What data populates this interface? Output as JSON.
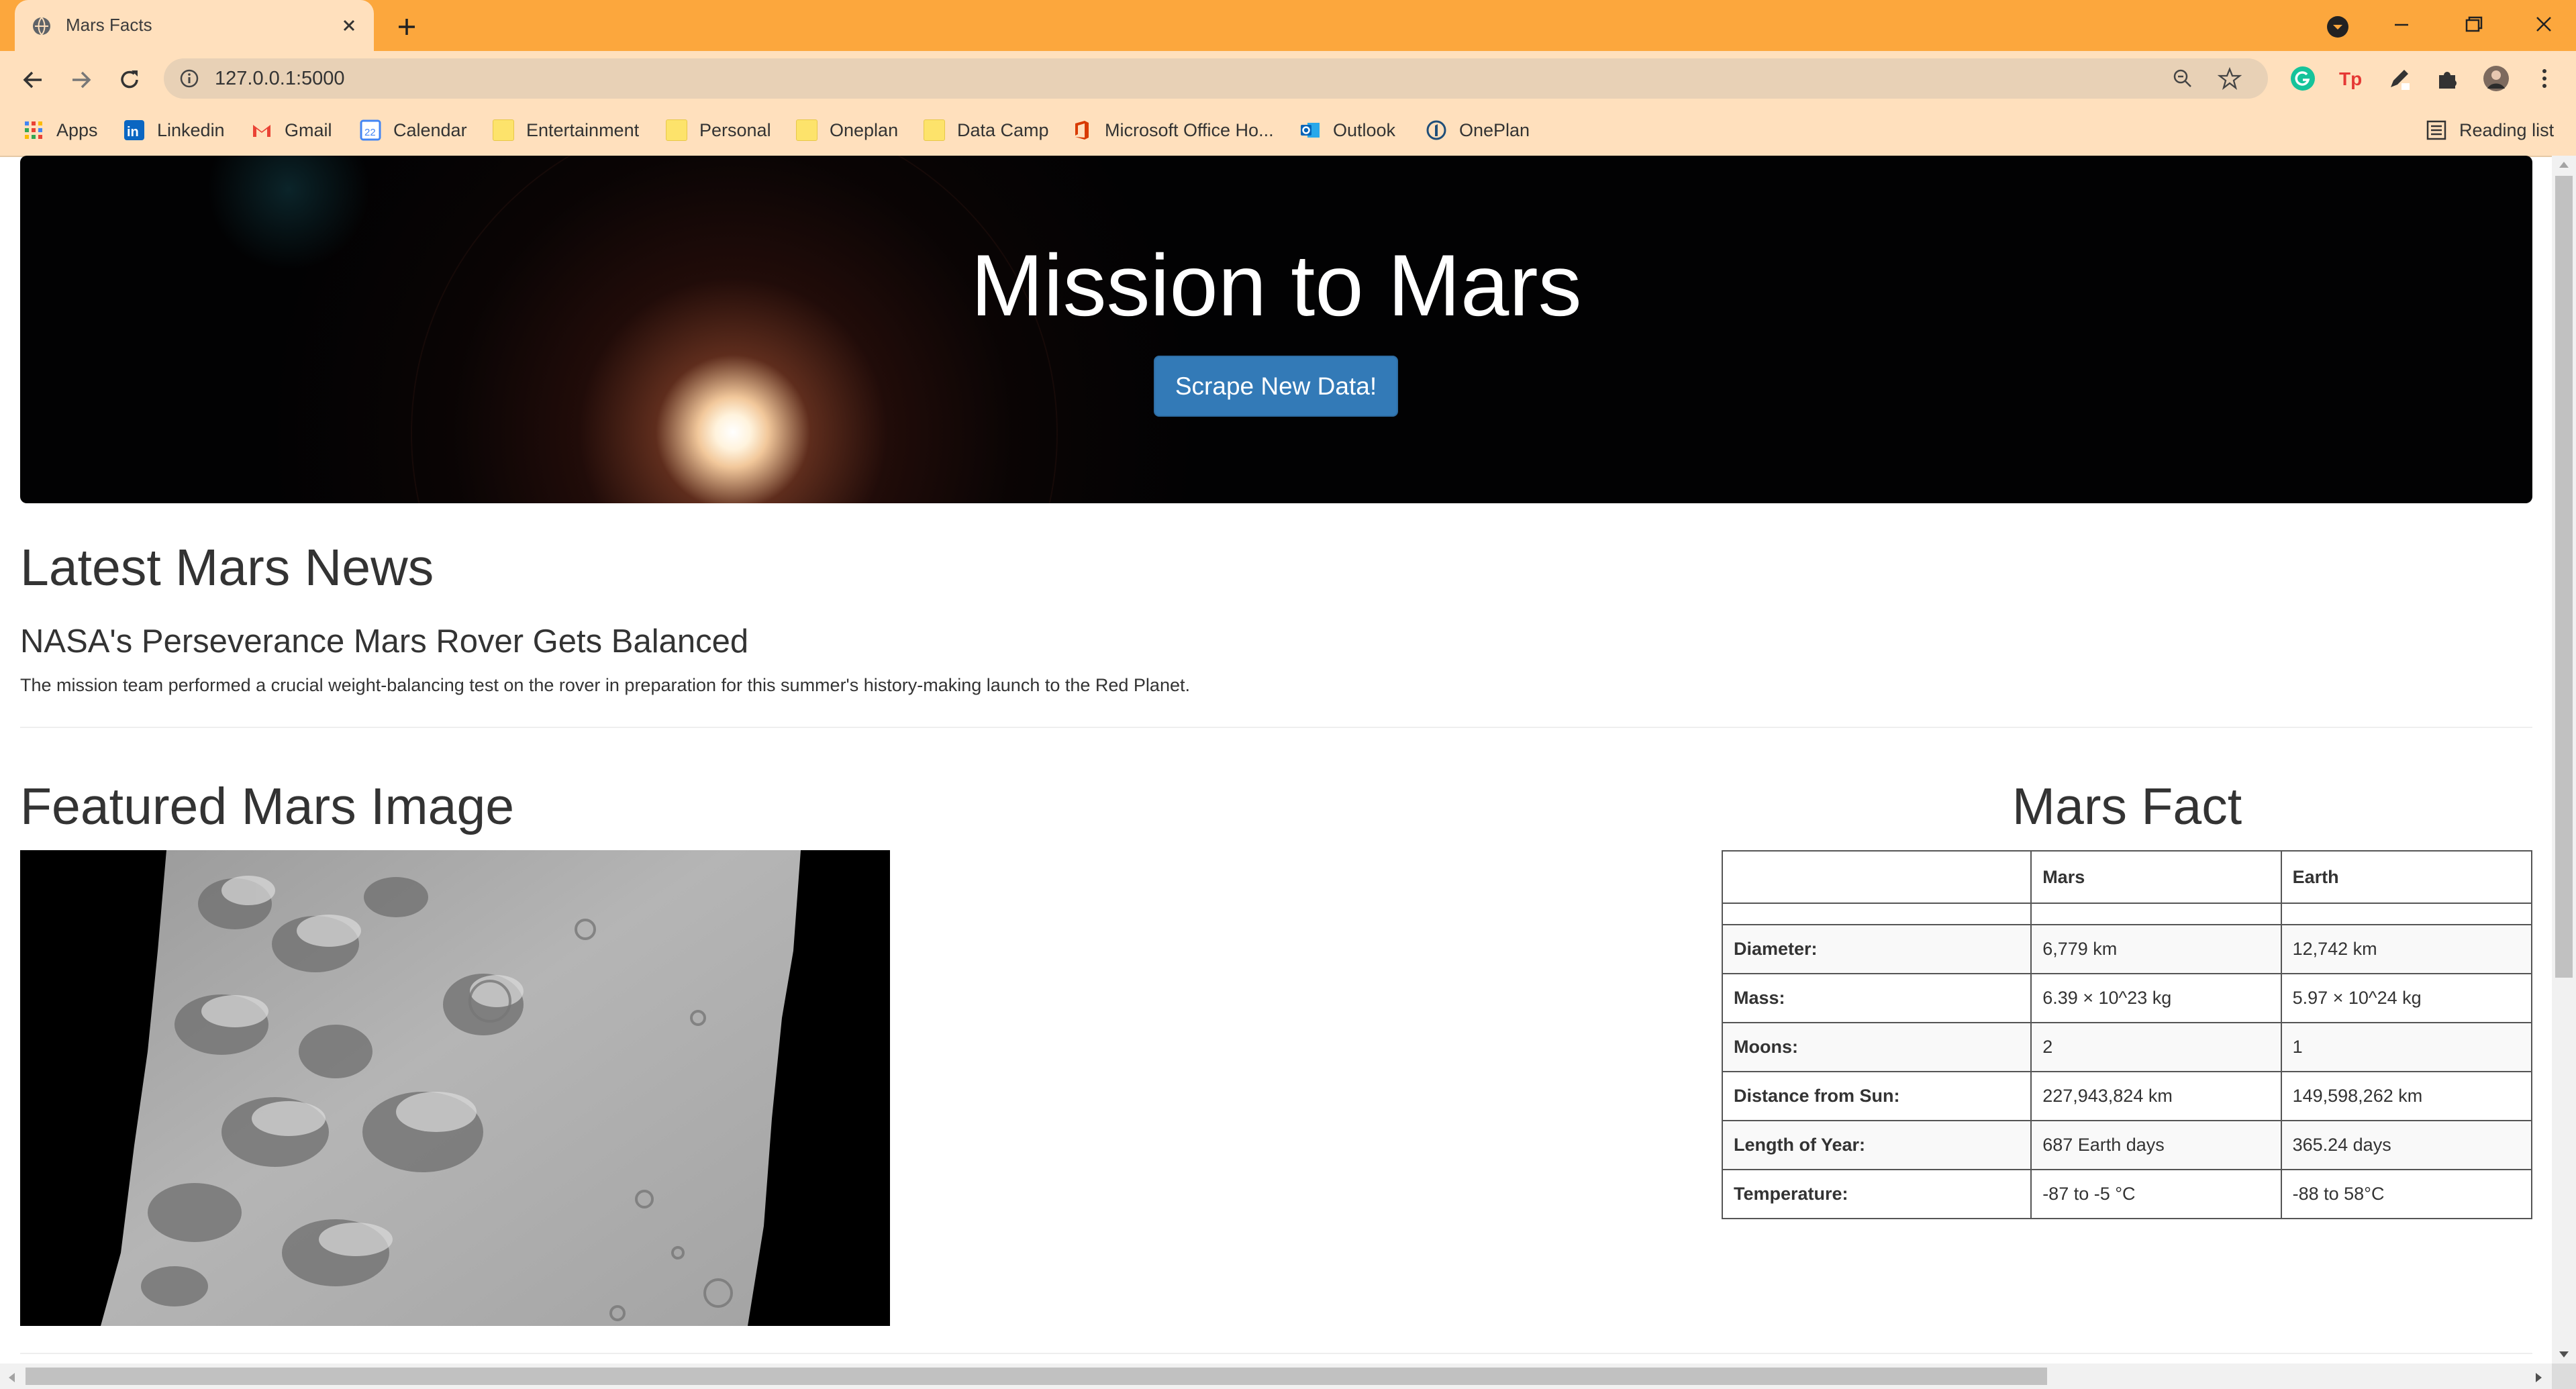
{
  "browser": {
    "tab_title": "Mars Facts",
    "url": "127.0.0.1:5000",
    "bookmarks": [
      "Apps",
      "Linkedin",
      "Gmail",
      "Calendar",
      "Entertainment",
      "Personal",
      "Oneplan",
      "Data Camp",
      "Microsoft Office Ho...",
      "Outlook",
      "OnePlan"
    ],
    "reading_list": "Reading list",
    "calendar_day": "22",
    "accent_color": "#fca73d"
  },
  "hero": {
    "title": "Mission to Mars",
    "button_label": "Scrape New Data!",
    "button_color": "#337ab7"
  },
  "news": {
    "heading": "Latest Mars News",
    "title": "NASA's Perseverance Mars Rover Gets Balanced",
    "body": "The mission team performed a crucial weight-balancing test on the rover in preparation for this summer's history-making launch to the Red Planet."
  },
  "featured": {
    "heading": "Featured Mars Image"
  },
  "facts": {
    "heading": "Mars Fact",
    "columns": [
      "",
      "Mars",
      "Earth"
    ],
    "rows": [
      {
        "label": "Diameter:",
        "mars": "6,779 km",
        "earth": "12,742 km"
      },
      {
        "label": "Mass:",
        "mars": "6.39 × 10^23 kg",
        "earth": "5.97 × 10^24 kg"
      },
      {
        "label": "Moons:",
        "mars": "2",
        "earth": "1"
      },
      {
        "label": "Distance from Sun:",
        "mars": "227,943,824 km",
        "earth": "149,598,262 km"
      },
      {
        "label": "Length of Year:",
        "mars": "687 Earth days",
        "earth": "365.24 days"
      },
      {
        "label": "Temperature:",
        "mars": "-87 to -5 °C",
        "earth": "-88 to 58°C"
      }
    ]
  }
}
